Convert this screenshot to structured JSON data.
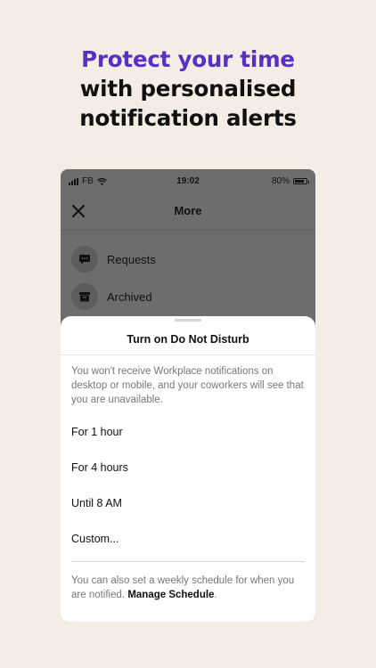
{
  "headline": {
    "accent": "Protect your time",
    "line1": "with personalised",
    "line2": "notification alerts"
  },
  "status_bar": {
    "carrier": "FB",
    "time": "19:02",
    "battery_text": "80%",
    "battery_level": 0.8
  },
  "nav": {
    "title": "More"
  },
  "menu": [
    {
      "label": "Requests",
      "icon": "chat-bubble-icon"
    },
    {
      "label": "Archived",
      "icon": "archive-box-icon"
    }
  ],
  "sheet": {
    "title": "Turn on Do Not Disturb",
    "description": "You won't receive Workplace notifications on desktop or mobile, and your coworkers will see that you are unavailable.",
    "options": [
      "For 1 hour",
      "For 4 hours",
      "Until 8 AM",
      "Custom..."
    ],
    "footer_text": "You can also set a weekly schedule for when you are notified.",
    "footer_link": "Manage Schedule",
    "footer_end": "."
  },
  "colors": {
    "background": "#f4ede6",
    "accent": "#5a2fc4",
    "overlay": "#6d6d6d"
  }
}
